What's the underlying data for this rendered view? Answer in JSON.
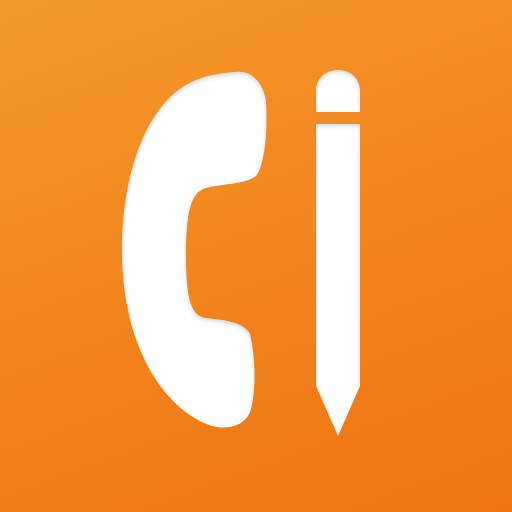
{
  "icon": {
    "symbol": "phone-and-pencil-icon",
    "background_color": "#f2861f",
    "background_top_color": "#f49a2e",
    "background_bottom_color": "#ee7412",
    "glyph_color": "#ffffff"
  }
}
